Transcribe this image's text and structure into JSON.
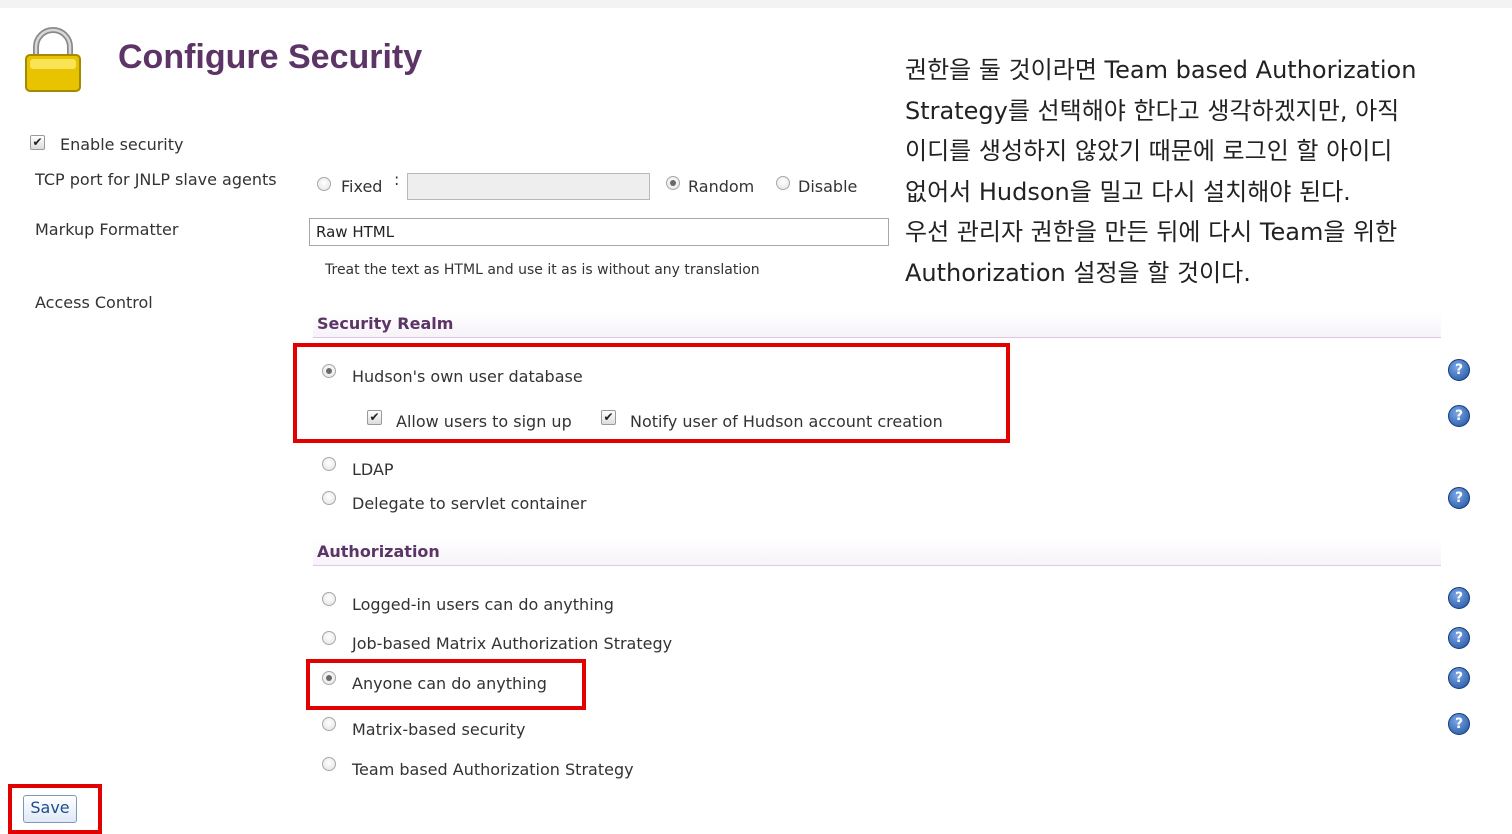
{
  "page": {
    "title": "Configure Security"
  },
  "general": {
    "enable_security_label": "Enable security",
    "tcp_port_label": "TCP port for JNLP slave agents",
    "tcp_options": {
      "fixed": "Fixed",
      "colon": ":",
      "random": "Random",
      "disable": "Disable"
    },
    "tcp_selected": "random",
    "tcp_fixed_value": "",
    "markup_formatter_label": "Markup Formatter",
    "markup_formatter_value": "Raw HTML",
    "markup_formatter_desc": "Treat the text as HTML and use it as is without any translation",
    "access_control_label": "Access Control"
  },
  "security_realm": {
    "heading": "Security Realm",
    "options": [
      {
        "label": "Hudson's own user database",
        "selected": true
      },
      {
        "label": "LDAP",
        "selected": false
      },
      {
        "label": "Delegate to servlet container",
        "selected": false
      }
    ],
    "suboptions": {
      "allow_signup": "Allow users to sign up",
      "notify_user": "Notify user of Hudson account creation"
    }
  },
  "authorization": {
    "heading": "Authorization",
    "options": [
      {
        "label": "Logged-in users can do anything",
        "selected": false
      },
      {
        "label": "Job-based Matrix Authorization Strategy",
        "selected": false
      },
      {
        "label": "Anyone can do anything",
        "selected": true
      },
      {
        "label": "Matrix-based security",
        "selected": false
      },
      {
        "label": "Team based Authorization Strategy",
        "selected": false
      }
    ]
  },
  "help_icon": "?",
  "buttons": {
    "save": "Save"
  },
  "annotation": {
    "lines": [
      "권한을 둘 것이라면 Team based Authorization",
      "Strategy를 선택해야 한다고 생각하겠지만, 아직",
      "이디를 생성하지 않았기 때문에 로그인 할 아이디",
      "없어서 Hudson을 밀고 다시 설치해야 된다.",
      "우선 관리자 권한을 만든 뒤에 다시 Team을 위한",
      "Authorization 설정을 할 것이다."
    ]
  },
  "colors": {
    "title": "#5c3566",
    "highlight_box": "#e30000",
    "help_icon": "#1f4f9e"
  }
}
